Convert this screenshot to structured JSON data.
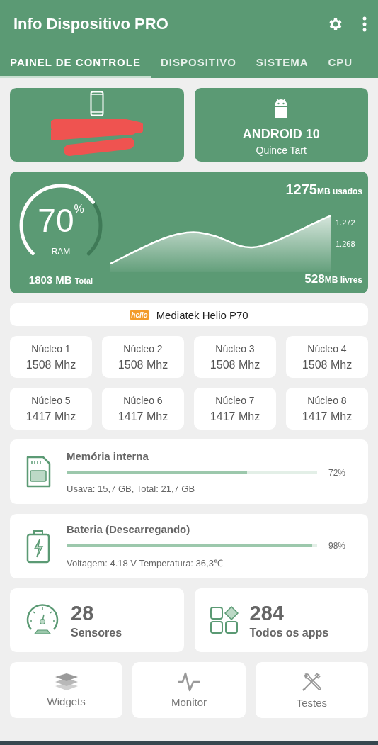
{
  "app_bar": {
    "title": "Info Dispositivo PRO"
  },
  "tabs": [
    {
      "label": "PAINEL DE CONTROLE",
      "selected": true
    },
    {
      "label": "DISPOSITIVO",
      "selected": false
    },
    {
      "label": "SISTEMA",
      "selected": false
    },
    {
      "label": "CPU",
      "selected": false
    }
  ],
  "device_card": {
    "redacted": true
  },
  "os_card": {
    "title": "ANDROID 10",
    "subtitle": "Quince Tart"
  },
  "ram": {
    "percent": "70",
    "percent_sign": "%",
    "label": "RAM",
    "level": 0.7,
    "total_value": "1803 MB",
    "total_unit": "Total",
    "used_value": "1275",
    "used_unit": "MB usados",
    "free_value": "528",
    "free_unit": "MB livres",
    "axis_labels": [
      "1.272",
      "1.268"
    ]
  },
  "chip": {
    "logo": "helio",
    "name": "Mediatek Helio P70"
  },
  "cores": [
    {
      "label": "Núcleo 1",
      "value": "1508 Mhz"
    },
    {
      "label": "Núcleo 2",
      "value": "1508 Mhz"
    },
    {
      "label": "Núcleo 3",
      "value": "1508 Mhz"
    },
    {
      "label": "Núcleo 4",
      "value": "1508 Mhz"
    },
    {
      "label": "Núcleo 5",
      "value": "1417 Mhz"
    },
    {
      "label": "Núcleo 6",
      "value": "1417 Mhz"
    },
    {
      "label": "Núcleo 7",
      "value": "1417 Mhz"
    },
    {
      "label": "Núcleo 8",
      "value": "1417 Mhz"
    }
  ],
  "meters": [
    {
      "kind": "storage",
      "title": "Memória interna",
      "level": 0.72,
      "reading": "72%",
      "details": "Usava: 15,7 GB,  Total: 21,7 GB"
    },
    {
      "kind": "battery",
      "title": "Bateria (Descarregando)",
      "level": 0.98,
      "reading": "98%",
      "details": "Voltagem: 4.18 V  Temperatura: 36,3℃"
    }
  ],
  "counters": [
    {
      "kind": "sensors",
      "count": "28",
      "label": "Sensores"
    },
    {
      "kind": "apps",
      "count": "284",
      "label": "Todos os apps"
    }
  ],
  "shortcuts": [
    {
      "kind": "widgets",
      "label": "Widgets"
    },
    {
      "kind": "monitor",
      "label": "Monitor"
    },
    {
      "kind": "tests",
      "label": "Testes"
    }
  ]
}
